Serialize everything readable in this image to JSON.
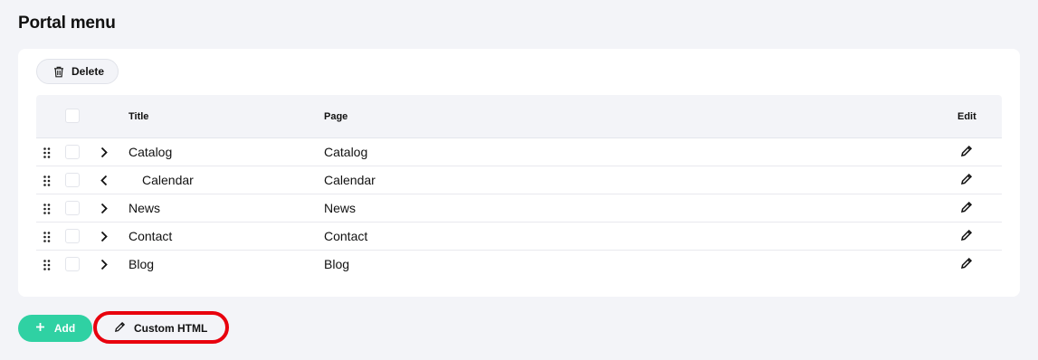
{
  "page": {
    "title": "Portal menu"
  },
  "toolbar": {
    "delete_label": "Delete"
  },
  "table": {
    "headers": {
      "title": "Title",
      "page": "Page",
      "edit": "Edit"
    },
    "rows": [
      {
        "title": "Catalog",
        "page": "Catalog",
        "chevron": "chevron-right-icon"
      },
      {
        "title": "Calendar",
        "page": "Calendar",
        "chevron": "chevron-left-icon"
      },
      {
        "title": "News",
        "page": "News",
        "chevron": "chevron-right-icon"
      },
      {
        "title": "Contact",
        "page": "Contact",
        "chevron": "chevron-right-icon"
      },
      {
        "title": "Blog",
        "page": "Blog",
        "chevron": "chevron-right-icon"
      }
    ]
  },
  "actions": {
    "add_label": "Add",
    "custom_html_label": "Custom HTML"
  },
  "colors": {
    "add_button": "#2fd1a3",
    "highlight": "#e8000d",
    "background": "#f3f4f8"
  }
}
